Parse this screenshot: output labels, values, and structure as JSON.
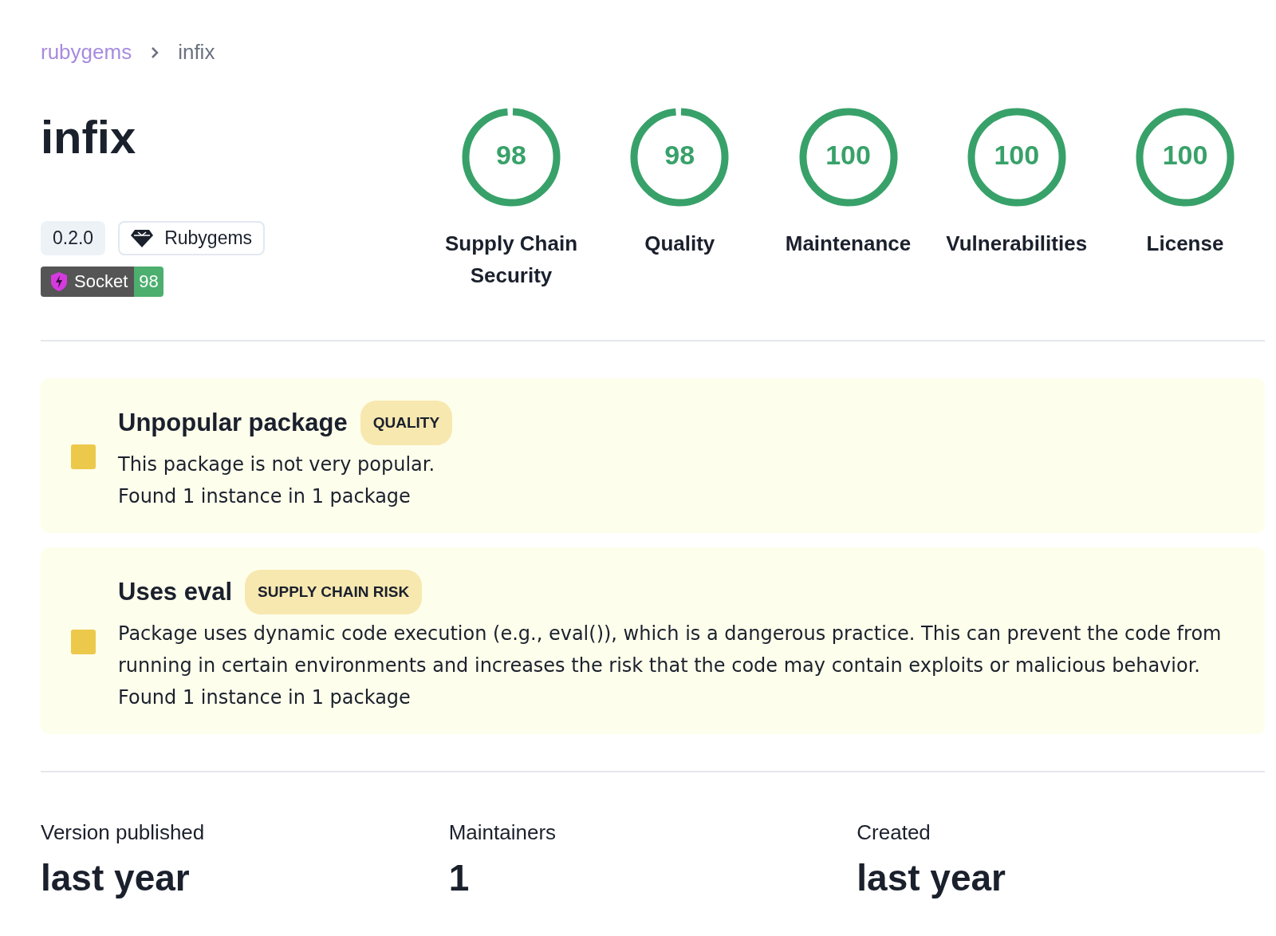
{
  "breadcrumb": [
    {
      "label": "rubygems",
      "kind": "link"
    },
    {
      "label": "infix",
      "kind": "current"
    }
  ],
  "package": {
    "name": "infix",
    "version": "0.2.0",
    "ecosystem": "Rubygems",
    "socket_badge": {
      "label": "Socket",
      "score": "98"
    }
  },
  "scores": [
    {
      "value": "98",
      "label": "Supply Chain Security",
      "level": 0.98
    },
    {
      "value": "98",
      "label": "Quality",
      "level": 0.98
    },
    {
      "value": "100",
      "label": "Maintenance",
      "level": 1
    },
    {
      "value": "100",
      "label": "Vulnerabilities",
      "level": 1
    },
    {
      "value": "100",
      "label": "License",
      "level": 1
    }
  ],
  "alerts": [
    {
      "title": "Unpopular package",
      "tag": "QUALITY",
      "description": "This package is not very popular.",
      "found": "Found 1 instance in 1 package"
    },
    {
      "title": "Uses eval",
      "tag": "SUPPLY CHAIN RISK",
      "description": "Package uses dynamic code execution (e.g., eval()), which is a dangerous practice. This can prevent the code from running in certain environments and increases the risk that the code may contain exploits or malicious behavior.",
      "found": "Found 1 instance in 1 package"
    }
  ],
  "stats": [
    {
      "label": "Version published",
      "value": "last year"
    },
    {
      "label": "Maintainers",
      "value": "1"
    },
    {
      "label": "Created",
      "value": "last year"
    }
  ]
}
